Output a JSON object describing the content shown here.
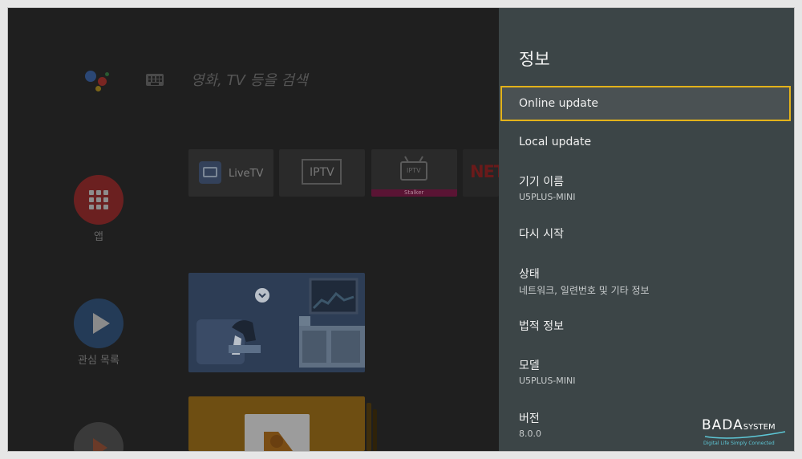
{
  "home": {
    "search_placeholder": "영화, TV 등을 검색",
    "side": {
      "apps_label": "앱",
      "watchlist_label": "관심 목록"
    },
    "channels": {
      "livetv_label": "LiveTV",
      "iptv_label": "IPTV",
      "stalker_tile_label": "IPTV",
      "stalker_caption": "Stalker",
      "netflix_label": "NET"
    }
  },
  "panel": {
    "title": "정보",
    "items": [
      {
        "title": "Online update",
        "sub": ""
      },
      {
        "title": "Local update",
        "sub": ""
      },
      {
        "title": "기기 이름",
        "sub": "U5PLUS-MINI"
      },
      {
        "title": "다시 시작",
        "sub": ""
      },
      {
        "title": "상태",
        "sub": "네트워크, 일련번호 및 기타 정보"
      },
      {
        "title": "법적 정보",
        "sub": ""
      },
      {
        "title": "모델",
        "sub": "U5PLUS-MINI"
      },
      {
        "title": "버전",
        "sub": "8.0.0"
      }
    ]
  },
  "watermark": {
    "brand": "BADA",
    "brand_suffix": "SYSTEM",
    "tagline": "Digital Life Simply Connected"
  },
  "colors": {
    "panel_bg": "#3c4547",
    "selection_border": "#e3b21a",
    "apps_button": "#8b2323",
    "watchlist_button": "#2d4a6d",
    "stalker_bar": "#b0005a"
  }
}
